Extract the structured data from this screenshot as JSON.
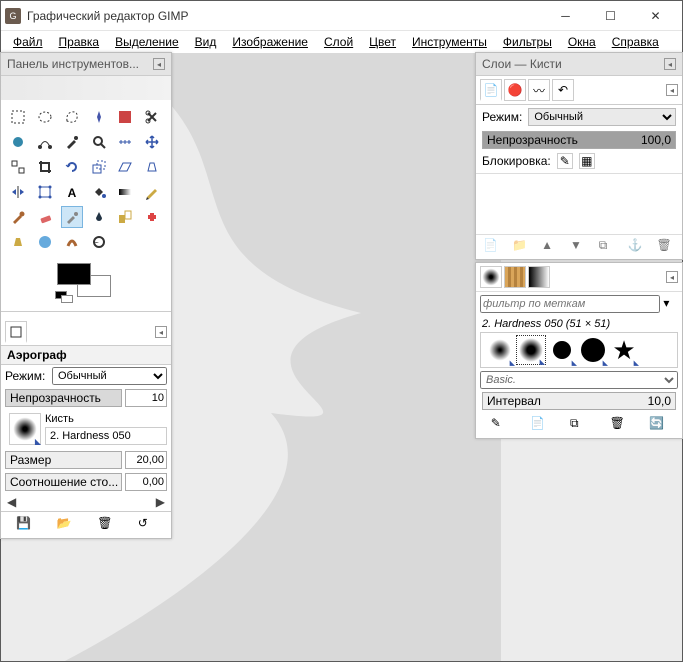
{
  "window": {
    "title": "Графический редактор GIMP"
  },
  "menu": [
    "Файл",
    "Правка",
    "Выделение",
    "Вид",
    "Изображение",
    "Слой",
    "Цвет",
    "Инструменты",
    "Фильтры",
    "Окна",
    "Справка"
  ],
  "toolbox": {
    "header": "Панель инструментов...",
    "tools": [
      "rect-select",
      "ellipse-select",
      "free-select",
      "fuzzy-select",
      "by-color-select",
      "scissors",
      "foreground-select",
      "paths",
      "color-picker",
      "zoom",
      "measure",
      "move",
      "align",
      "crop",
      "rotate",
      "scale",
      "shear",
      "perspective",
      "flip",
      "cage",
      "text",
      "bucket-fill",
      "blend",
      "pencil",
      "paintbrush",
      "eraser",
      "airbrush",
      "ink",
      "clone",
      "heal",
      "perspective-clone",
      "blur",
      "smudge",
      "dodge"
    ],
    "selected_tool": "airbrush"
  },
  "tool_options": {
    "title": "Аэрограф",
    "mode_label": "Режим:",
    "mode_value": "Обычный",
    "opacity_label": "Непрозрачность",
    "opacity_value": "10",
    "brush_label": "Кисть",
    "brush_name": "2. Hardness 050",
    "size_label": "Размер",
    "size_value": "20,00",
    "aspect_label": "Соотношение сто...",
    "aspect_value": "0,00"
  },
  "layers_panel": {
    "header": "Слои — Кисти",
    "mode_label": "Режим:",
    "mode_value": "Обычный",
    "opacity_label": "Непрозрачность",
    "opacity_value": "100,0",
    "lock_label": "Блокировка:"
  },
  "brushes_panel": {
    "filter_placeholder": "фильтр по меткам",
    "brush_info": "2. Hardness 050 (51 × 51)",
    "category": "Basic.",
    "interval_label": "Интервал",
    "interval_value": "10,0"
  }
}
